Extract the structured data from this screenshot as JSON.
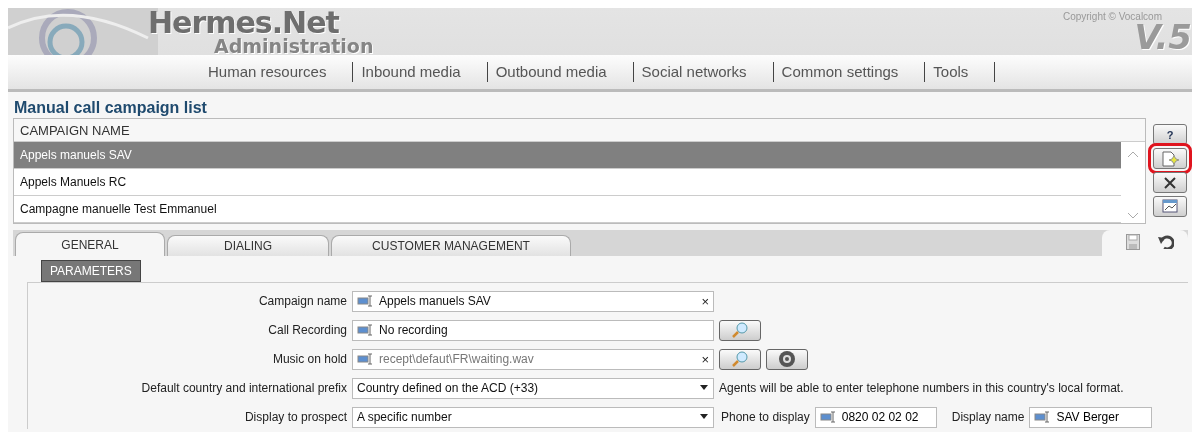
{
  "header": {
    "title": "Hermes.Net",
    "subtitle": "Administration",
    "copyright": "Copyright © Vocalcom",
    "version": "V.5"
  },
  "menu": [
    "Human resources",
    "Inbound media",
    "Outbound media",
    "Social networks",
    "Common settings",
    "Tools"
  ],
  "list": {
    "title": "Manual call campaign list",
    "column": "CAMPAIGN NAME",
    "rows": [
      {
        "name": "Appels manuels SAV",
        "selected": true
      },
      {
        "name": "Appels Manuels RC",
        "selected": false
      },
      {
        "name": "Campagne manuelle Test Emmanuel",
        "selected": false
      }
    ]
  },
  "side_buttons": [
    {
      "kind": "help",
      "label": "?",
      "highlighted": false
    },
    {
      "kind": "new",
      "highlighted": true
    },
    {
      "kind": "delete",
      "highlighted": false
    },
    {
      "kind": "report",
      "highlighted": false
    }
  ],
  "tabs": [
    {
      "label": "GENERAL",
      "selected": true
    },
    {
      "label": "DIALING",
      "selected": false
    },
    {
      "label": "CUSTOMER MANAGEMENT",
      "selected": false
    }
  ],
  "section": "PARAMETERS",
  "form": [
    {
      "label": "Campaign name",
      "kind": "text",
      "value": "Appels manuels SAV",
      "disabled": false,
      "clear": "×"
    },
    {
      "label": "Call Recording",
      "kind": "text",
      "value": "No recording",
      "disabled": false,
      "buttons": [
        {
          "kind": "search"
        }
      ]
    },
    {
      "label": "Music on hold",
      "kind": "text",
      "value": "recept\\defaut\\FR\\waiting.wav",
      "disabled": true,
      "clear": "×",
      "buttons": [
        {
          "kind": "search"
        },
        {
          "kind": "play"
        }
      ]
    },
    {
      "label": "Default country and international prefix",
      "kind": "select",
      "value": "Country defined on the ACD (+33)",
      "note": "Agents will be able to enter telephone numbers in this country's local format."
    },
    {
      "label": "Display to prospect",
      "kind": "select",
      "value": "A specific number",
      "extras": [
        {
          "label": "Phone to display",
          "value": "0820 02 02 02"
        },
        {
          "label": "Display name",
          "value": "SAV Berger"
        }
      ]
    }
  ]
}
